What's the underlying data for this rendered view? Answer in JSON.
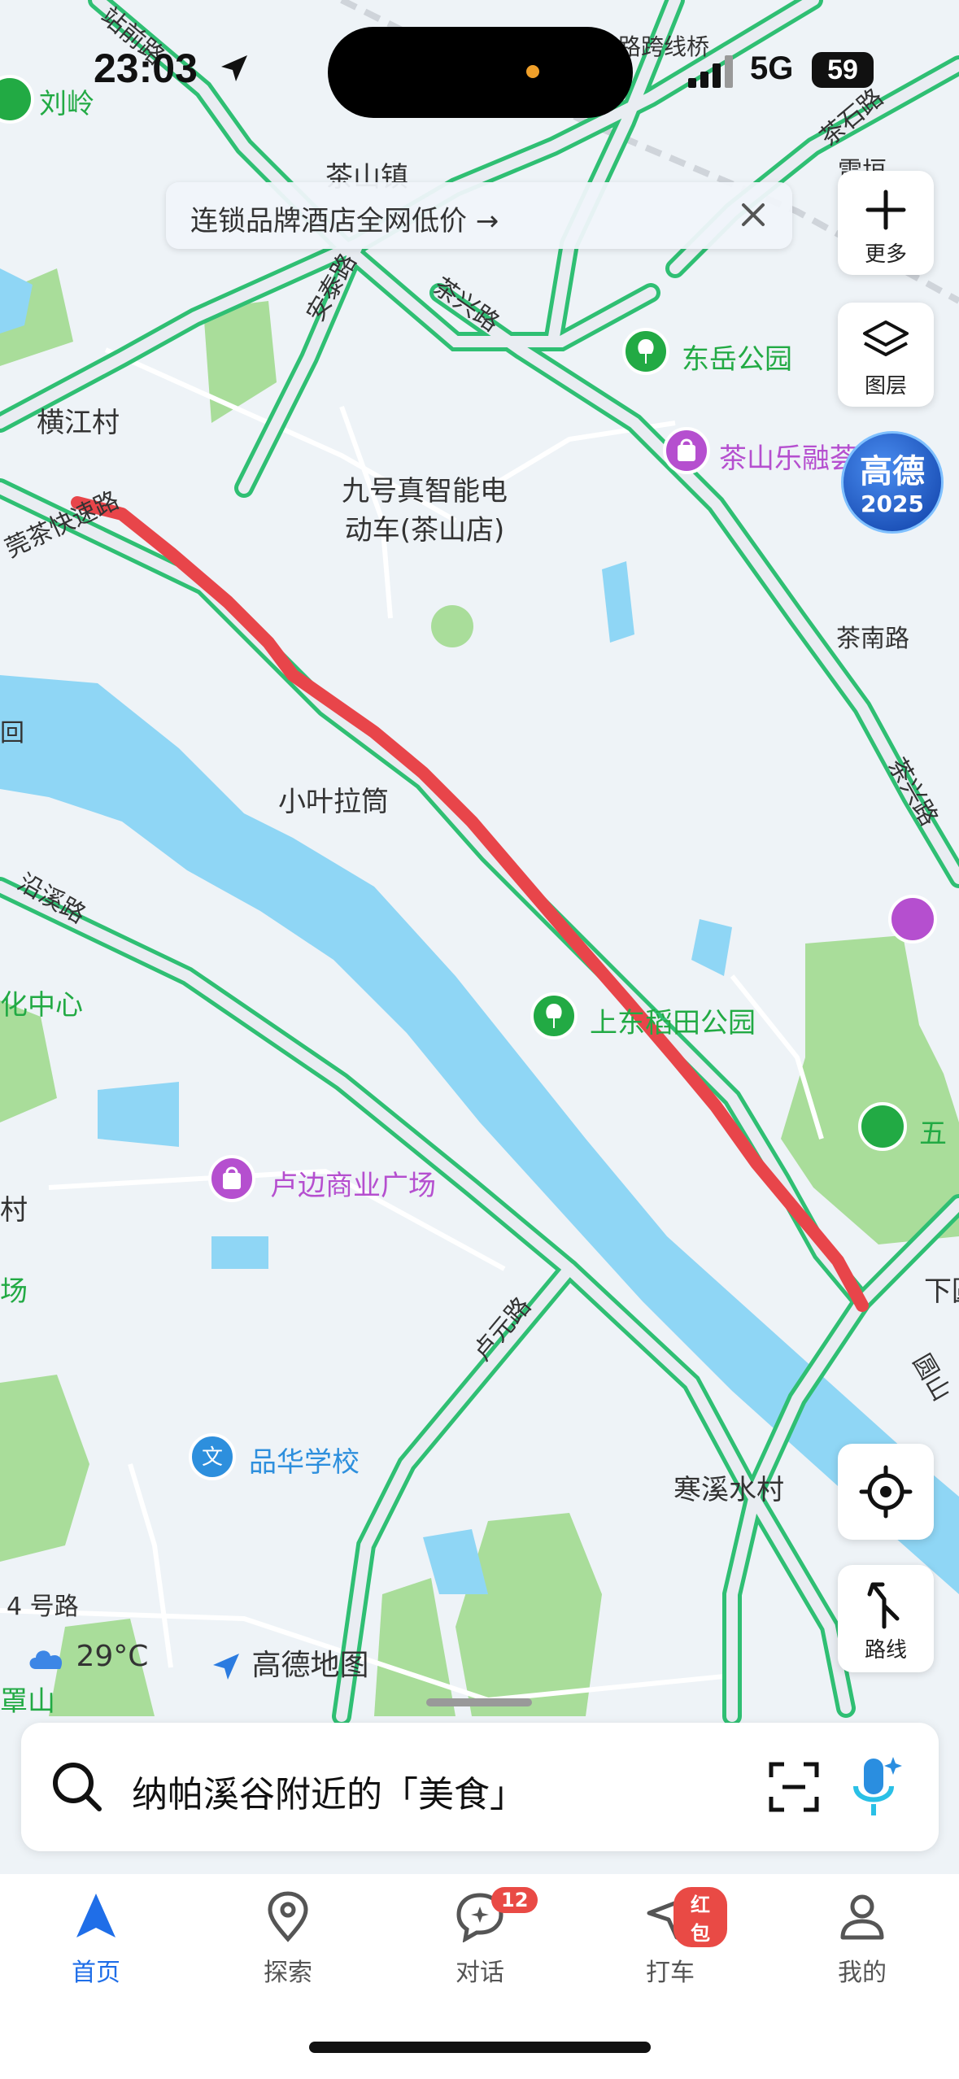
{
  "status_bar": {
    "time": "23:03",
    "network": "5G",
    "battery": "59"
  },
  "promo_banner": {
    "text": "连锁品牌酒店全网低价 →"
  },
  "side_controls": {
    "more_label": "更多",
    "layers_label": "图层",
    "route_label": "路线",
    "badge_line1": "高德",
    "badge_line2": "2025"
  },
  "map_labels": {
    "liuling": "刘岭",
    "road_zhanqian": "站前路",
    "chashan_town": "茶山镇",
    "anqin_road": "安泰路",
    "chaxing_road": "茶兴路",
    "road_overpass": "路跨线桥",
    "chashi_road": "茶石路",
    "leiken": "雷垣",
    "dongyue_park": "东岳公园",
    "hengjiang": "横江村",
    "expressway": "莞茶快速路",
    "jiuhao": "九号真智能电\n动车(茶山店)",
    "chashan_lerong": "茶山乐融荟",
    "chanan_road": "茶南路",
    "chaxing_road_2": "茶兴路",
    "xiaoye": "小叶拉筒",
    "yanxi_road": "沿溪路",
    "culture_center": "化中心",
    "shangdong_park": "上东稻田公园",
    "wu": "五",
    "lubian_plaza": "卢边商业广场",
    "luyuan_road": "卢元路",
    "xiayuan": "下圆",
    "yuanshan_road": "圆山",
    "hanxi_village": "寒溪水村",
    "pinhua_school": "品华学校",
    "road_4": "4 号路",
    "zhaoshan": "罩山",
    "partial_cun": "村",
    "partial_chang": "场",
    "partial_hui": "回"
  },
  "weather": {
    "temp": "29°C",
    "brand": "高德地图"
  },
  "search": {
    "placeholder": "纳帕溪谷附近的「美食」"
  },
  "tabs": [
    {
      "label": "首页"
    },
    {
      "label": "探索"
    },
    {
      "label": "对话",
      "badge": "12"
    },
    {
      "label": "打车",
      "badge": "红包"
    },
    {
      "label": "我的"
    }
  ]
}
